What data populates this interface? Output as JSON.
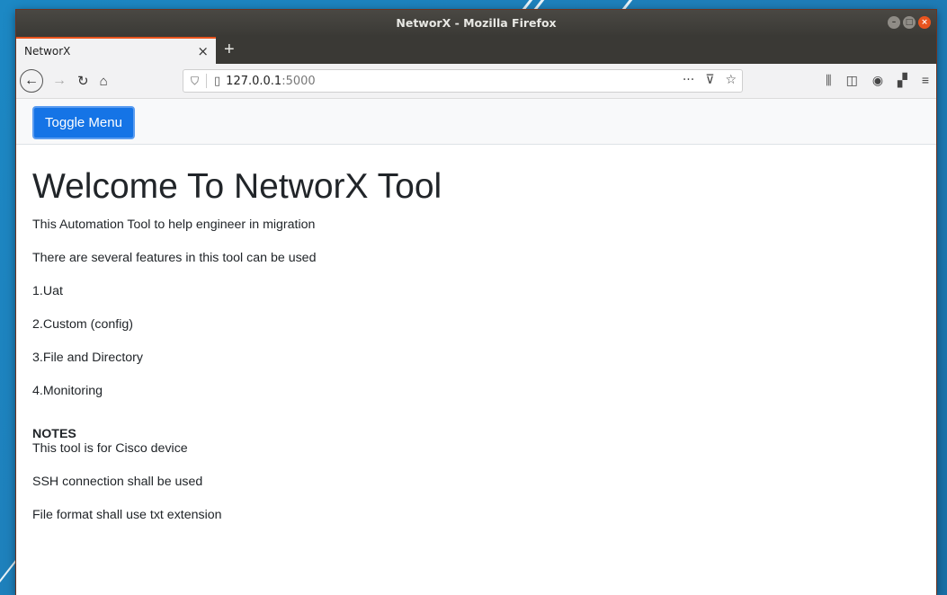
{
  "window": {
    "title": "NetworX - Mozilla Firefox"
  },
  "tab": {
    "label": "NetworX",
    "close_glyph": "×",
    "newtab_glyph": "+"
  },
  "navbar": {
    "url_host": "127.0.0.1",
    "url_port": ":5000",
    "actions_more": "···"
  },
  "page": {
    "toggle_label": "Toggle Menu",
    "heading": "Welcome To NetworX Tool",
    "intro": [
      "This Automation Tool to help engineer in migration",
      "There are several features in this tool can be used"
    ],
    "features": [
      "1.Uat",
      "2.Custom (config)",
      "3.File and Directory",
      "4.Monitoring"
    ],
    "notes_title": "NOTES",
    "notes": [
      "This tool is for Cisco device",
      "SSH connection shall be used",
      "File format shall use txt extension"
    ]
  },
  "colors": {
    "accent": "#e8541e",
    "button": "#1574e6",
    "desktop": "#1f7db8"
  },
  "icons": [
    "back-icon",
    "forward-icon",
    "reload-icon",
    "home-icon",
    "shield-icon",
    "page-icon",
    "more-icon",
    "pocket-icon",
    "bookmark-star-icon",
    "library-icon",
    "sidebar-icon",
    "account-icon",
    "extensions-icon",
    "menu-icon"
  ]
}
